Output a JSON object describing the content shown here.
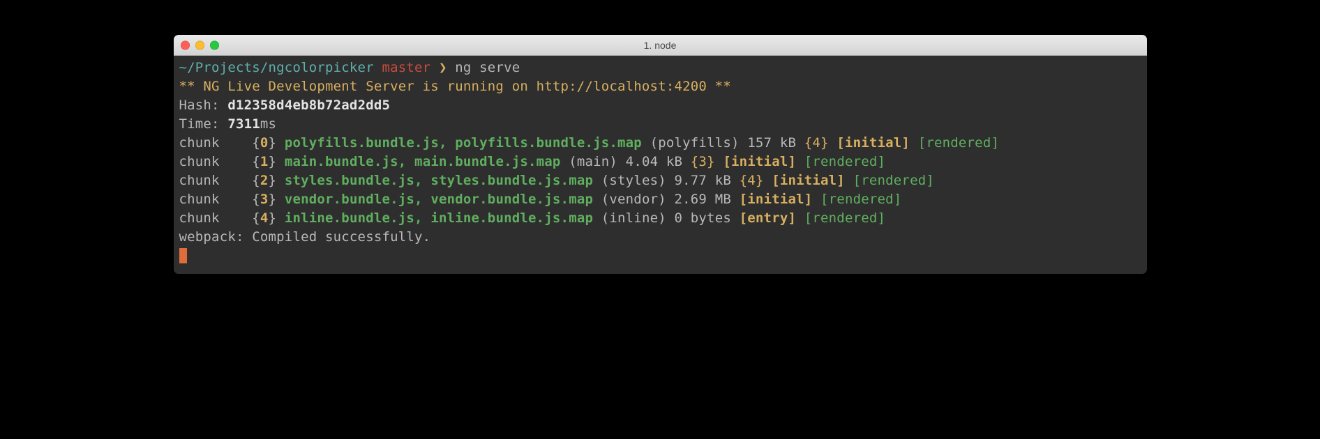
{
  "window": {
    "title": "1. node"
  },
  "prompt": {
    "path": "~/Projects/ngcolorpicker",
    "branch": "master",
    "arrow": "❯",
    "command": "ng serve"
  },
  "banner": "** NG Live Development Server is running on http://localhost:4200 **",
  "hashLabel": "Hash: ",
  "hashValue": "d12358d4eb8b72ad2dd5",
  "timeLabel": "Time: ",
  "timeValue": "7311",
  "timeUnit": "ms",
  "chunks": [
    {
      "prefix": "chunk    ",
      "idOpen": "{",
      "id": "0",
      "idClose": "} ",
      "files": "polyfills.bundle.js, polyfills.bundle.js.map",
      "meta": " (polyfills) 157 kB ",
      "dep": "{4}",
      "sp": " ",
      "tag1": "[initial]",
      "sp2": " ",
      "tag2": "[rendered]"
    },
    {
      "prefix": "chunk    ",
      "idOpen": "{",
      "id": "1",
      "idClose": "} ",
      "files": "main.bundle.js, main.bundle.js.map",
      "meta": " (main) 4.04 kB ",
      "dep": "{3}",
      "sp": " ",
      "tag1": "[initial]",
      "sp2": " ",
      "tag2": "[rendered]"
    },
    {
      "prefix": "chunk    ",
      "idOpen": "{",
      "id": "2",
      "idClose": "} ",
      "files": "styles.bundle.js, styles.bundle.js.map",
      "meta": " (styles) 9.77 kB ",
      "dep": "{4}",
      "sp": " ",
      "tag1": "[initial]",
      "sp2": " ",
      "tag2": "[rendered]"
    },
    {
      "prefix": "chunk    ",
      "idOpen": "{",
      "id": "3",
      "idClose": "} ",
      "files": "vendor.bundle.js, vendor.bundle.js.map",
      "meta": " (vendor) 2.69 MB ",
      "dep": "",
      "sp": "",
      "tag1": "[initial]",
      "sp2": " ",
      "tag2": "[rendered]"
    },
    {
      "prefix": "chunk    ",
      "idOpen": "{",
      "id": "4",
      "idClose": "} ",
      "files": "inline.bundle.js, inline.bundle.js.map",
      "meta": " (inline) 0 bytes ",
      "dep": "",
      "sp": "",
      "tag1": "[entry]",
      "sp2": " ",
      "tag2": "[rendered]"
    }
  ],
  "footer": "webpack: Compiled successfully."
}
